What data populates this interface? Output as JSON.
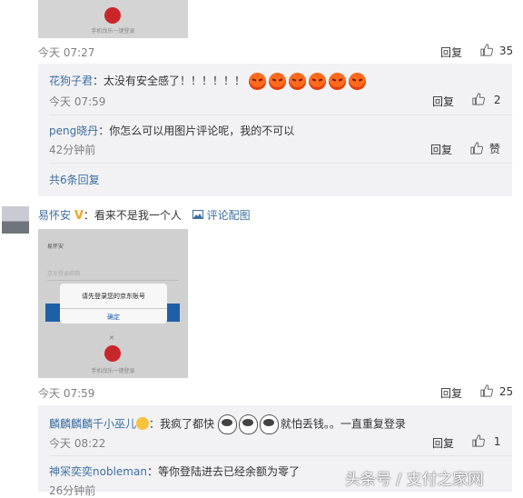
{
  "thumb1": {
    "caption": "手机伐乐一键登录"
  },
  "c1": {
    "time": "今天 07:27",
    "reply": "回复",
    "likes": "35"
  },
  "r1": {
    "name": "花狗子君",
    "text": "太没有安全感了！！！！！！",
    "time": "今天 07:59",
    "reply": "回复",
    "likes": "2"
  },
  "r2": {
    "name": "peng晓丹",
    "text": "你怎么可以用图片评论呢，我的不可以",
    "time": "42分钟前",
    "reply": "回复",
    "likes": "赞"
  },
  "more": {
    "label": "共6条回复"
  },
  "c2": {
    "name": "易怀安",
    "text": "看来不是我一个人",
    "pic_link": "评论配图",
    "time": "今天 07:59",
    "reply": "回复",
    "likes": "25"
  },
  "shot2": {
    "header": "易怀安",
    "field_placeholder": "京东登录邮箱",
    "dialog_text": "请先登录您的京东账号",
    "dialog_ok": "确定",
    "caption": "手机伐乐一键登录"
  },
  "r3": {
    "name": "麟麟麟麟千小巫儿",
    "text_a": "我疯了都快",
    "text_b": "就怕丢钱。。一直重复登录",
    "time": "今天 08:22",
    "reply": "回复",
    "likes": "1"
  },
  "r4": {
    "name": "神冞奕奕nobleman",
    "text": "等你登陆进去已经余额为零了",
    "time": "26分钟前"
  },
  "watermark": "头条号 / 支付之家网",
  "colors": {
    "link": "#3d6fa0",
    "meta": "#808080",
    "reply_bg": "#f2f2f5",
    "vip": "#f5a623"
  }
}
